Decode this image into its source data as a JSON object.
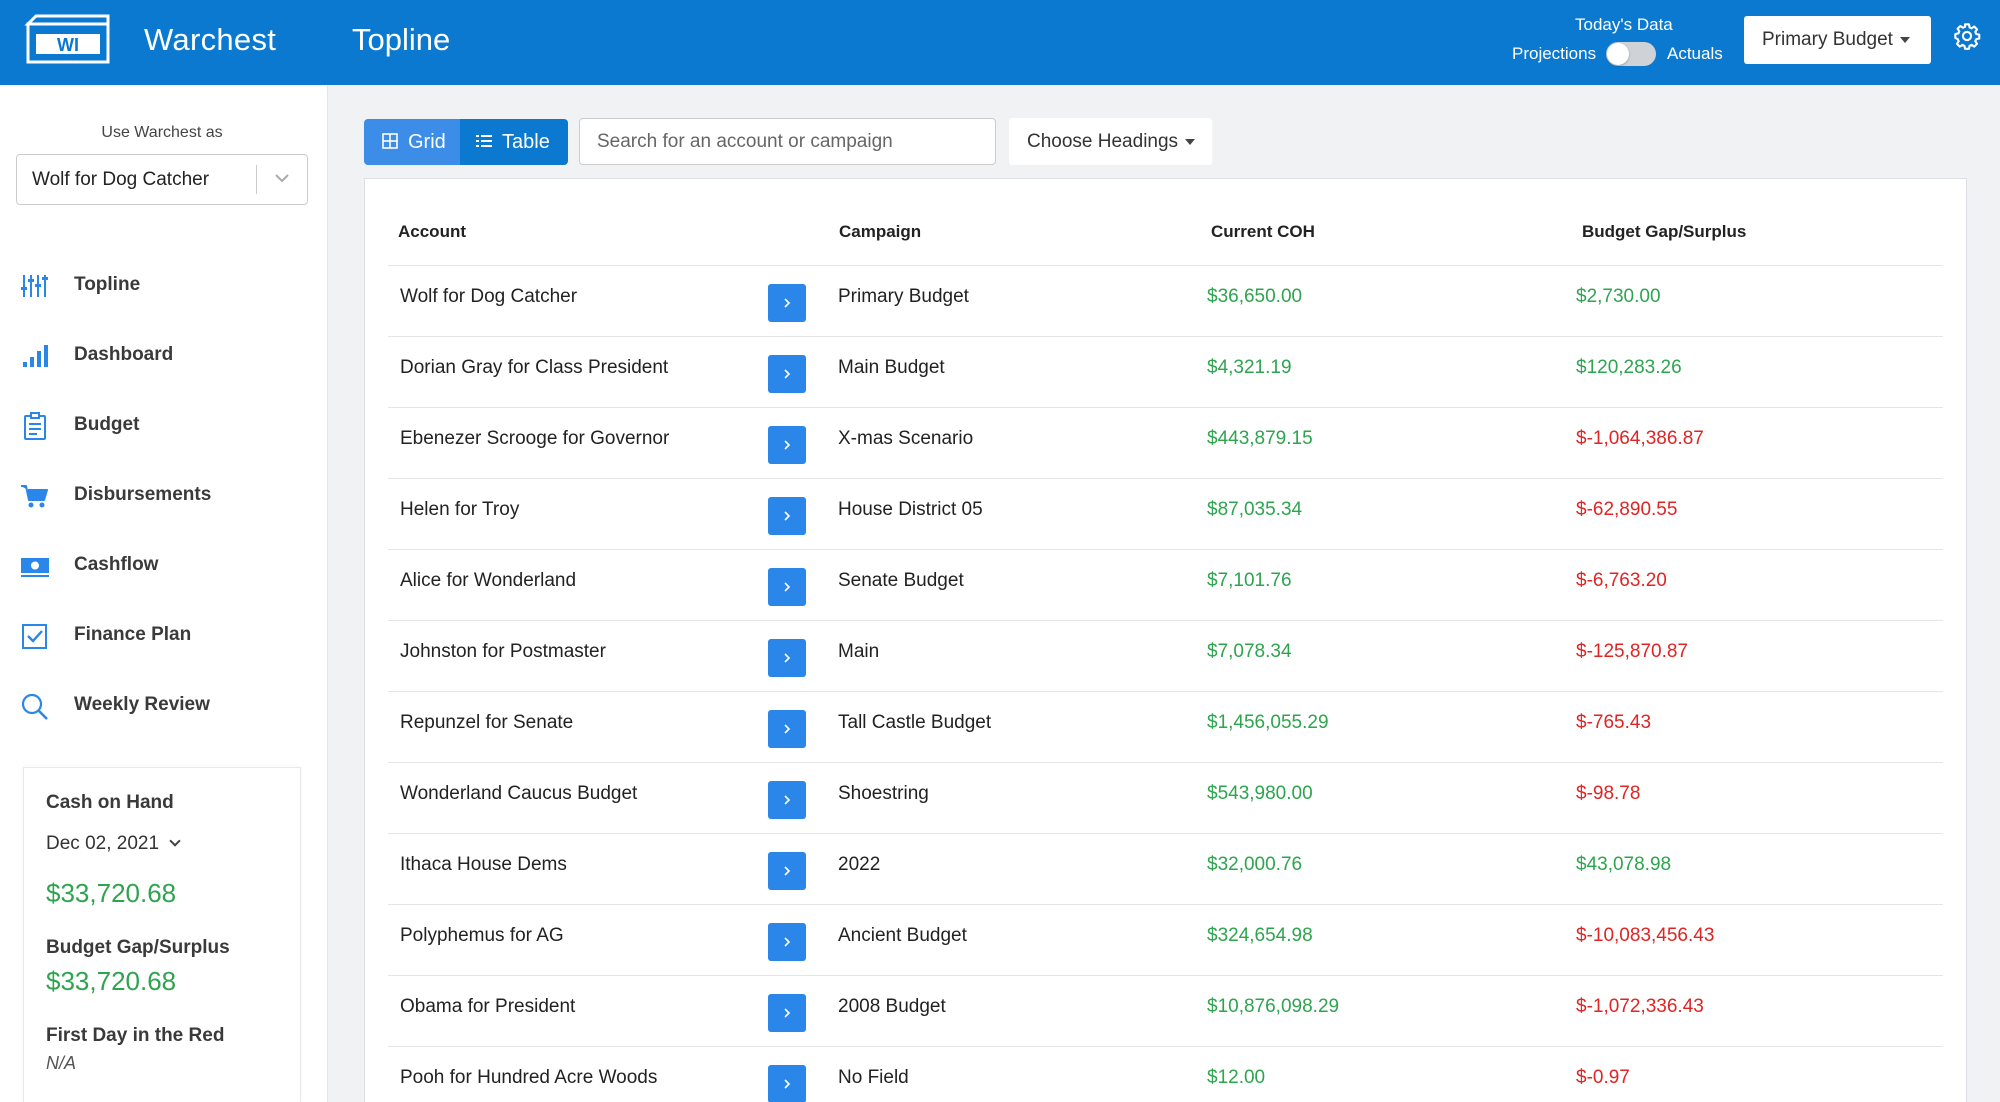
{
  "header": {
    "brand": "Warchest",
    "page_title": "Topline",
    "todays_data_label": "Today's Data",
    "projections_label": "Projections",
    "actuals_label": "Actuals",
    "budget_select": "Primary Budget",
    "settings_icon": "gear-icon",
    "logo_icon": "warchest-logo"
  },
  "sidebar": {
    "use_as_label": "Use Warchest as",
    "org_select": "Wolf for Dog Catcher",
    "nav": [
      {
        "label": "Topline",
        "icon": "sliders-icon"
      },
      {
        "label": "Dashboard",
        "icon": "bar-chart-icon"
      },
      {
        "label": "Budget",
        "icon": "clipboard-icon"
      },
      {
        "label": "Disbursements",
        "icon": "cart-icon"
      },
      {
        "label": "Cashflow",
        "icon": "money-icon"
      },
      {
        "label": "Finance Plan",
        "icon": "checkbox-icon"
      },
      {
        "label": "Weekly Review",
        "icon": "search-icon"
      }
    ],
    "summary": {
      "cash_on_hand_label": "Cash on Hand",
      "date": "Dec 02, 2021",
      "cash_on_hand_value": "$33,720.68",
      "gap_label": "Budget Gap/Surplus",
      "gap_value": "$33,720.68",
      "first_red_label": "First Day in the Red",
      "first_red_value": "N/A"
    }
  },
  "toolbar": {
    "grid_label": "Grid",
    "table_label": "Table",
    "search_placeholder": "Search for an account or campaign",
    "headings_label": "Choose Headings"
  },
  "table": {
    "columns": [
      "Account",
      "Campaign",
      "Current COH",
      "Budget Gap/Surplus"
    ],
    "rows": [
      {
        "account": "Wolf for Dog Catcher",
        "campaign": "Primary Budget",
        "coh": "$36,650.00",
        "gap": "$2,730.00",
        "gap_status": "pos"
      },
      {
        "account": "Dorian Gray for Class President",
        "campaign": "Main Budget",
        "coh": "$4,321.19",
        "gap": "$120,283.26",
        "gap_status": "pos"
      },
      {
        "account": "Ebenezer Scrooge for Governor",
        "campaign": "X-mas Scenario",
        "coh": "$443,879.15",
        "gap": "$-1,064,386.87",
        "gap_status": "neg"
      },
      {
        "account": "Helen for Troy",
        "campaign": "House District 05",
        "coh": "$87,035.34",
        "gap": "$-62,890.55",
        "gap_status": "neg"
      },
      {
        "account": "Alice for Wonderland",
        "campaign": "Senate Budget",
        "coh": "$7,101.76",
        "gap": "$-6,763.20",
        "gap_status": "neg"
      },
      {
        "account": "Johnston for Postmaster",
        "campaign": "Main",
        "coh": "$7,078.34",
        "gap": "$-125,870.87",
        "gap_status": "neg"
      },
      {
        "account": "Repunzel for Senate",
        "campaign": "Tall Castle Budget",
        "coh": "$1,456,055.29",
        "gap": "$-765.43",
        "gap_status": "neg"
      },
      {
        "account": "Wonderland Caucus Budget",
        "campaign": "Shoestring",
        "coh": "$543,980.00",
        "gap": "$-98.78",
        "gap_status": "neg"
      },
      {
        "account": "Ithaca House Dems",
        "campaign": "2022",
        "coh": "$32,000.76",
        "gap": "$43,078.98",
        "gap_status": "pos"
      },
      {
        "account": "Polyphemus for AG",
        "campaign": "Ancient Budget",
        "coh": "$324,654.98",
        "gap": "$-10,083,456.43",
        "gap_status": "neg"
      },
      {
        "account": "Obama for President",
        "campaign": "2008 Budget",
        "coh": "$10,876,098.29",
        "gap": "$-1,072,336.43",
        "gap_status": "neg"
      },
      {
        "account": "Pooh for Hundred Acre Woods",
        "campaign": "No Field",
        "coh": "$12.00",
        "gap": "$-0.97",
        "gap_status": "neg"
      }
    ]
  }
}
